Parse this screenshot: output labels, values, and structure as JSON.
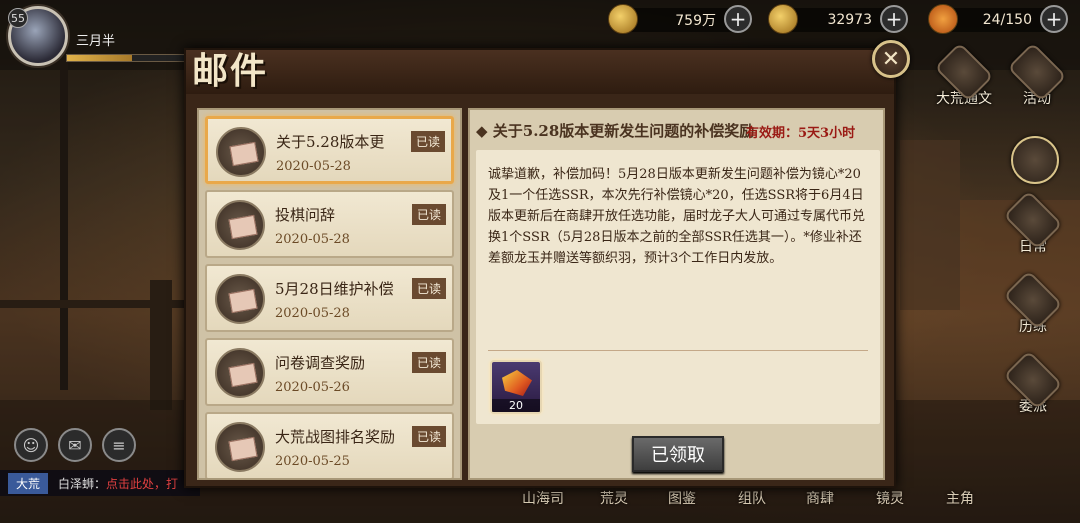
{
  "player": {
    "level": "55",
    "name": "三月半",
    "exp_progress": 0.55
  },
  "currencies": [
    {
      "icon": "coin-icon",
      "value": "759万"
    },
    {
      "icon": "jade-icon",
      "value": "32973"
    },
    {
      "icon": "stamina-icon",
      "value": "24/150"
    }
  ],
  "mail": {
    "title": "邮件",
    "items": [
      {
        "title": "关于5.28版本更",
        "date": "2020-05-28",
        "status": "已读",
        "selected": true
      },
      {
        "title": "投棋问辞",
        "date": "2020-05-28",
        "status": "已读"
      },
      {
        "title": "5月28日维护补偿",
        "date": "2020-05-28",
        "status": "已读"
      },
      {
        "title": "问卷调查奖励",
        "date": "2020-05-26",
        "status": "已读"
      },
      {
        "title": "大荒战图排名奖励",
        "date": "2020-05-25",
        "status": "已读"
      }
    ],
    "detail": {
      "title": "◆ 关于5.28版本更新发生问题的补偿奖励",
      "expire": "有效期：5天3小时",
      "body": "诚挚道歉，补偿加码！5月28日版本更新发生问题补偿为镜心*20及1一个任选SSR，本次先行补偿镜心*20，任选SSR将于6月4日版本更新后在商肆开放任选功能，届时龙子大人可通过专属代币兑换1个SSR（5月28日版本之前的全部SSR任选其一）。*修业补还差额龙玉并赠送等额织羽，预计3个工作日内发放。",
      "attachment": {
        "icon": "mirror-heart-gem-icon",
        "count": "20"
      },
      "claim_label": "已领取"
    }
  },
  "right_menu": [
    {
      "label": "大荒通文",
      "icon": "map-icon"
    },
    {
      "label": "活动",
      "icon": "activity-icon"
    },
    {
      "label": "",
      "icon": "character-portrait-icon"
    },
    {
      "label": "日常",
      "icon": "daily-icon"
    },
    {
      "label": "历练",
      "icon": "training-icon"
    },
    {
      "label": "委派",
      "icon": "dispatch-icon"
    }
  ],
  "bottom_nav": [
    "山海司",
    "荒灵",
    "图鉴",
    "组队",
    "商肆",
    "镜灵",
    "主角"
  ],
  "chat": {
    "channel": "大荒",
    "name": "白泽蛳：",
    "text": "点击此处，打"
  }
}
